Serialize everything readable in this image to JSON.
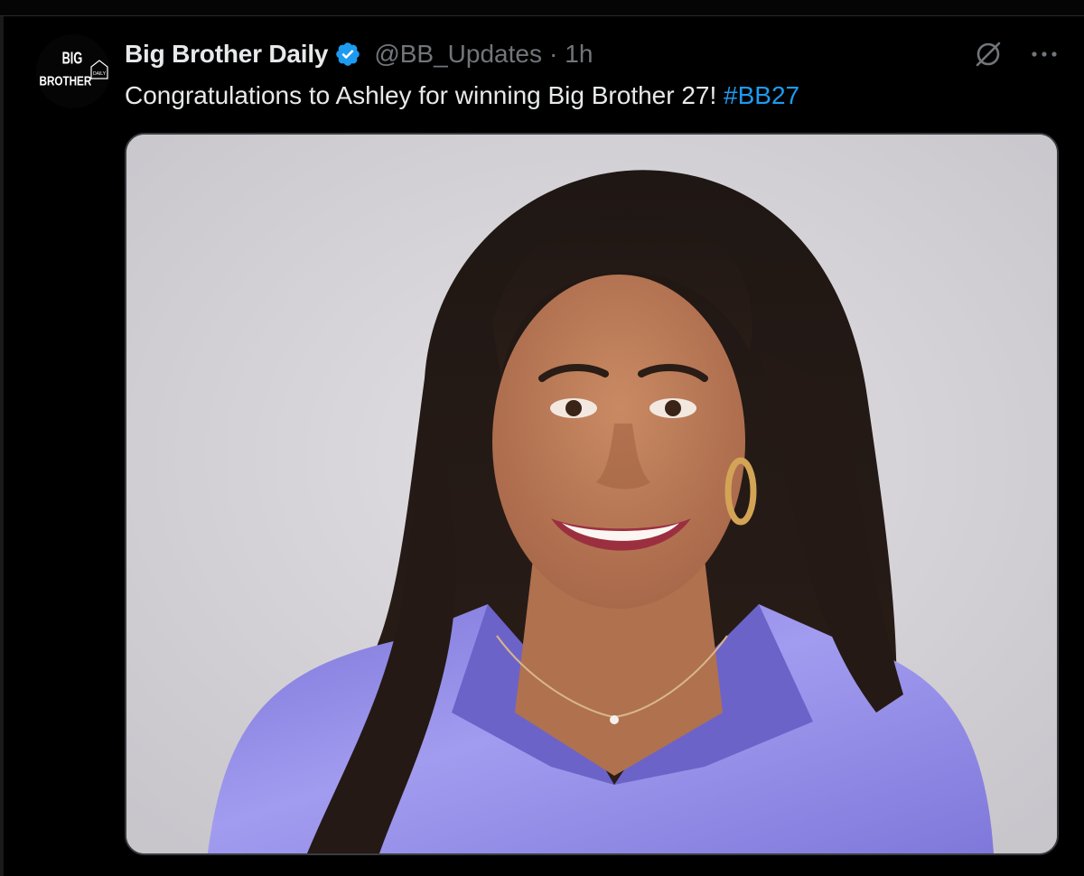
{
  "tweet": {
    "display_name": "Big Brother Daily",
    "handle": "@BB_Updates",
    "separator": "·",
    "time": "1h",
    "text": "Congratulations to Ashley for winning Big Brother 27!",
    "hashtag": "#BB27"
  },
  "avatar": {
    "logo_text": [
      "BIG",
      "BROTHER",
      "DAILY"
    ]
  },
  "icons": {
    "verified": "verified-badge-icon",
    "grok": "grok-icon",
    "more": "more-icon"
  },
  "colors": {
    "background": "#000000",
    "text_primary": "#e7e9ea",
    "text_secondary": "#71767b",
    "link": "#1d9bf0",
    "verified_badge": "#1d9bf0",
    "media_border": "#3a3d40",
    "photo_background": "#d6d4d8",
    "shirt": "#8f88e0"
  }
}
